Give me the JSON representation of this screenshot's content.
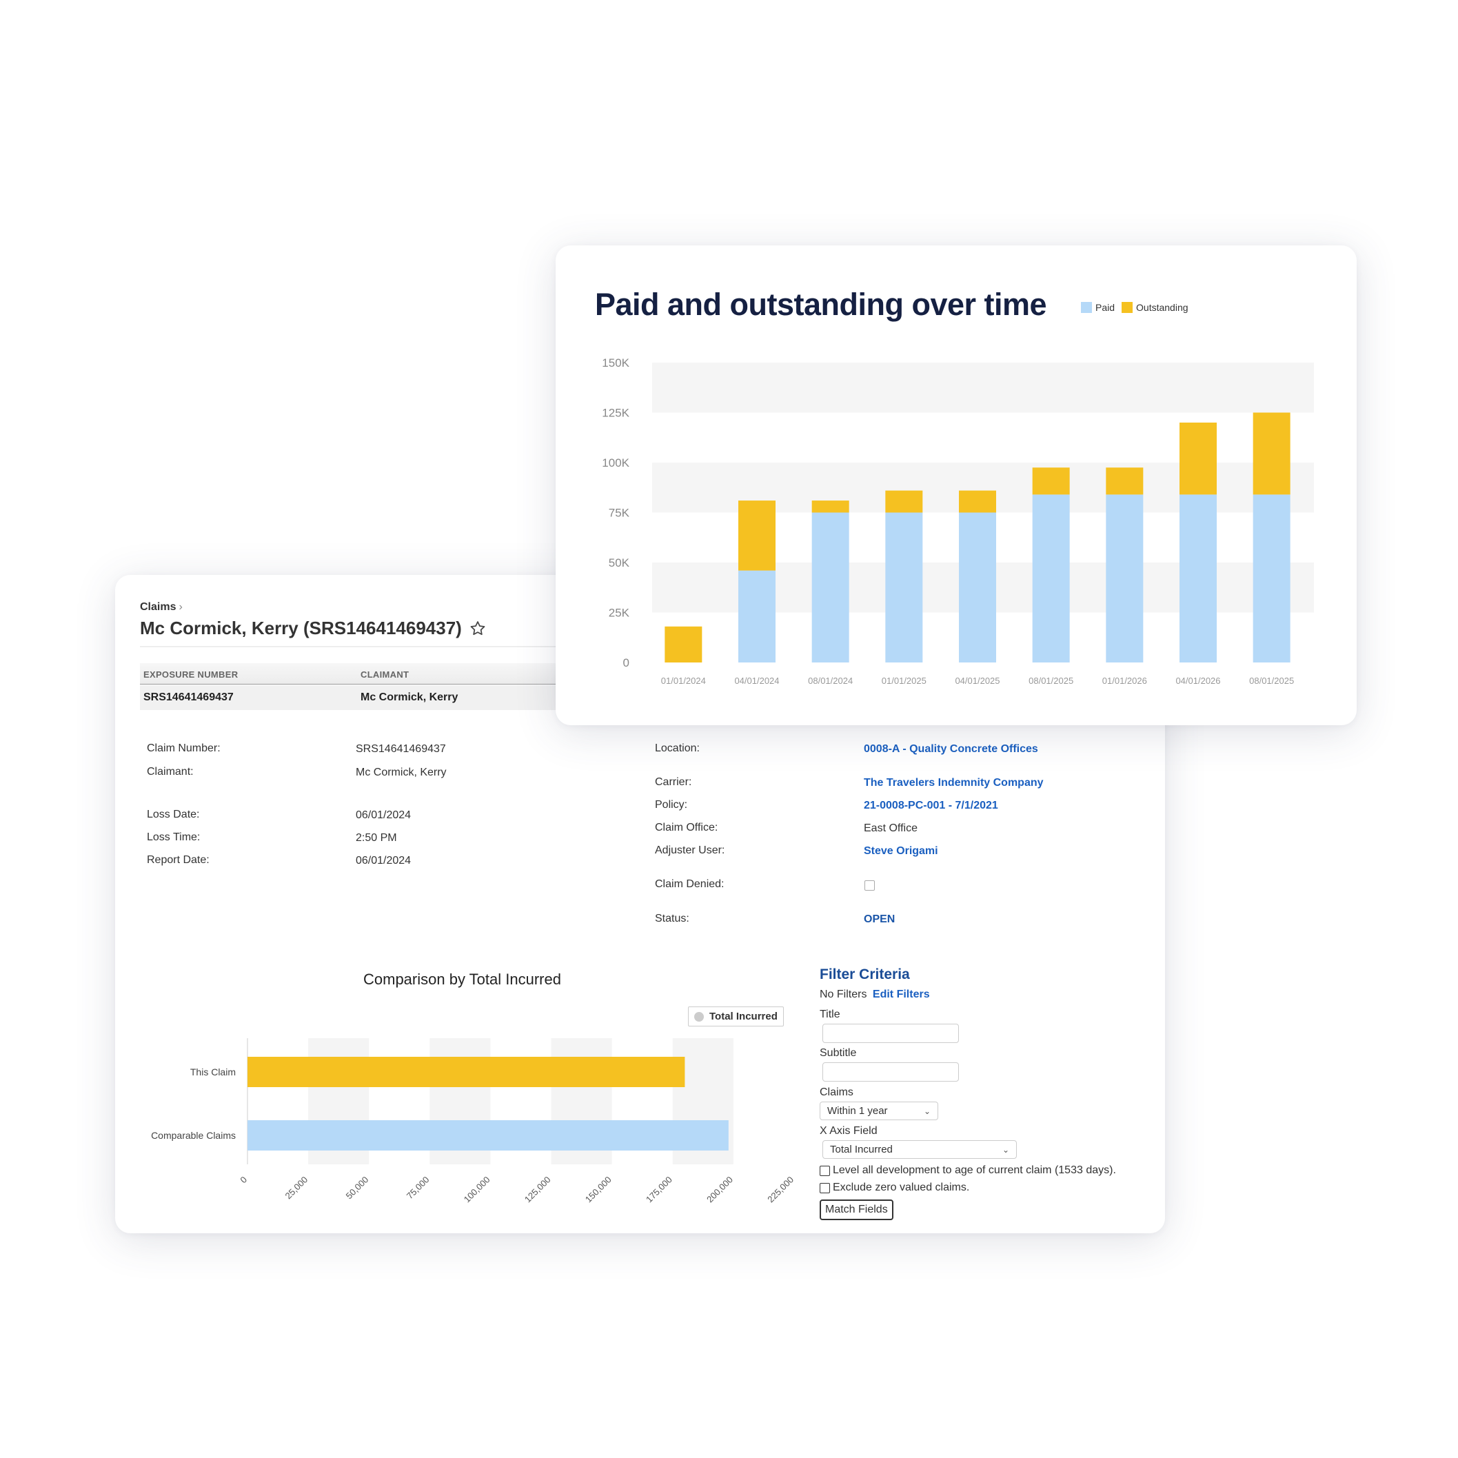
{
  "colors": {
    "paid": "#b5d9f8",
    "outstanding": "#f5c121",
    "link": "#1a5fc0",
    "title": "#152042"
  },
  "claim": {
    "breadcrumb": "Claims",
    "title": "Mc Cormick, Kerry (SRS14641469437)",
    "table": {
      "headers": [
        "EXPOSURE NUMBER",
        "CLAIMANT"
      ],
      "row": [
        "SRS14641469437",
        "Mc Cormick, Kerry"
      ]
    },
    "left_fields": [
      {
        "label": "Claim Number:",
        "value": "SRS14641469437"
      },
      {
        "label": "Claimant:",
        "value": "Mc Cormick, Kerry"
      },
      {
        "label": "Loss Date:",
        "value": "06/01/2024"
      },
      {
        "label": "Loss Time:",
        "value": "2:50 PM"
      },
      {
        "label": "Report Date:",
        "value": "06/01/2024"
      }
    ],
    "right_fields": {
      "location": {
        "label": "Location:",
        "value": "0008-A - Quality Concrete Offices"
      },
      "carrier": {
        "label": "Carrier:",
        "value": "The Travelers Indemnity Company"
      },
      "policy": {
        "label": "Policy:",
        "value": "21-0008-PC-001 - 7/1/2021"
      },
      "office": {
        "label": "Claim Office:",
        "value": "East Office"
      },
      "adjuster": {
        "label": "Adjuster User:",
        "value": "Steve Origami"
      },
      "denied": {
        "label": "Claim Denied:"
      },
      "status": {
        "label": "Status:",
        "value": "OPEN"
      }
    }
  },
  "filter": {
    "title": "Filter Criteria",
    "no_filters": "No Filters",
    "edit_filters": "Edit Filters",
    "title_label": "Title",
    "subtitle_label": "Subtitle",
    "claims_label": "Claims",
    "claims_value": "Within 1 year",
    "xaxis_label": "X Axis Field",
    "xaxis_value": "Total Incurred",
    "check_level": "Level all development to age of current claim (1533 days).",
    "check_exclude": "Exclude zero valued claims.",
    "match_button": "Match Fields"
  },
  "chart_data": [
    {
      "type": "bar",
      "orientation": "vertical",
      "stacked": true,
      "title": "Paid and outstanding over time",
      "categories": [
        "01/01/2024",
        "04/01/2024",
        "08/01/2024",
        "01/01/2025",
        "04/01/2025",
        "08/01/2025",
        "01/01/2026",
        "04/01/2026",
        "08/01/2025"
      ],
      "series": [
        {
          "name": "Paid",
          "values": [
            0,
            46000,
            75000,
            75000,
            75000,
            84000,
            84000,
            84000,
            84000
          ]
        },
        {
          "name": "Outstanding",
          "values": [
            18000,
            35000,
            6000,
            11000,
            11000,
            13500,
            13500,
            36000,
            41000
          ]
        }
      ],
      "yticks": [
        "0",
        "25K",
        "50K",
        "75K",
        "100K",
        "125K",
        "150K"
      ],
      "ylim": [
        0,
        150000
      ],
      "legend": "top-right",
      "grid": "alternating-bands"
    },
    {
      "type": "bar",
      "orientation": "horizontal",
      "title": "Comparison by Total Incurred",
      "categories": [
        "This Claim",
        "Comparable Claims"
      ],
      "series": [
        {
          "name": "Total Incurred",
          "values": [
            180000,
            198000
          ]
        }
      ],
      "xticks": [
        "0",
        "25,000",
        "50,000",
        "75,000",
        "100,000",
        "125,000",
        "150,000",
        "175,000",
        "200,000",
        "225,000"
      ],
      "xlim": [
        0,
        225000
      ],
      "legend": "top-right",
      "grid": "alternating-bands"
    }
  ]
}
